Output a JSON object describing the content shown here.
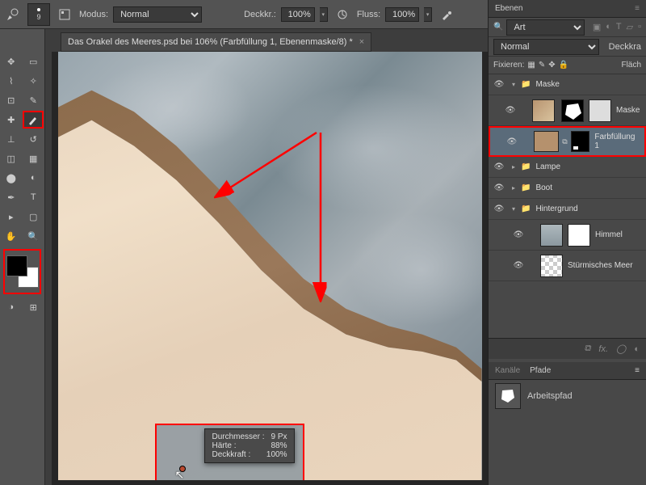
{
  "optionsbar": {
    "brush_size": "9",
    "mode_label": "Modus:",
    "mode_value": "Normal",
    "opacity_label": "Deckkr.:",
    "opacity_value": "100%",
    "flow_label": "Fluss:",
    "flow_value": "100%"
  },
  "document_tab": "Das Orakel des Meeres.psd bei 106% (Farbfüllung 1, Ebenenmaske/8) *",
  "tooltip": {
    "diameter_label": "Durchmesser :",
    "diameter_value": "9 Px",
    "hardness_label": "Härte :",
    "hardness_value": "88%",
    "opacity_label": "Deckkraft :",
    "opacity_value": "100%"
  },
  "panels": {
    "layers_tab": "Ebenen",
    "art_filter": "Art",
    "blend_mode": "Normal",
    "opacity_label": "Deckkra",
    "lock_label": "Fixieren:",
    "fill_label": "Fläch",
    "channels_tab": "Kanäle",
    "paths_tab": "Pfade",
    "workpath": "Arbeitspfad",
    "fx": "fx."
  },
  "layers": {
    "group_maske": "Maske",
    "layer_maske": "Maske",
    "layer_farbfuellung": "Farbfüllung 1",
    "group_lampe": "Lampe",
    "group_boot": "Boot",
    "group_hintergrund": "Hintergrund",
    "layer_himmel": "Himmel",
    "layer_meer": "Stürmisches Meer"
  }
}
